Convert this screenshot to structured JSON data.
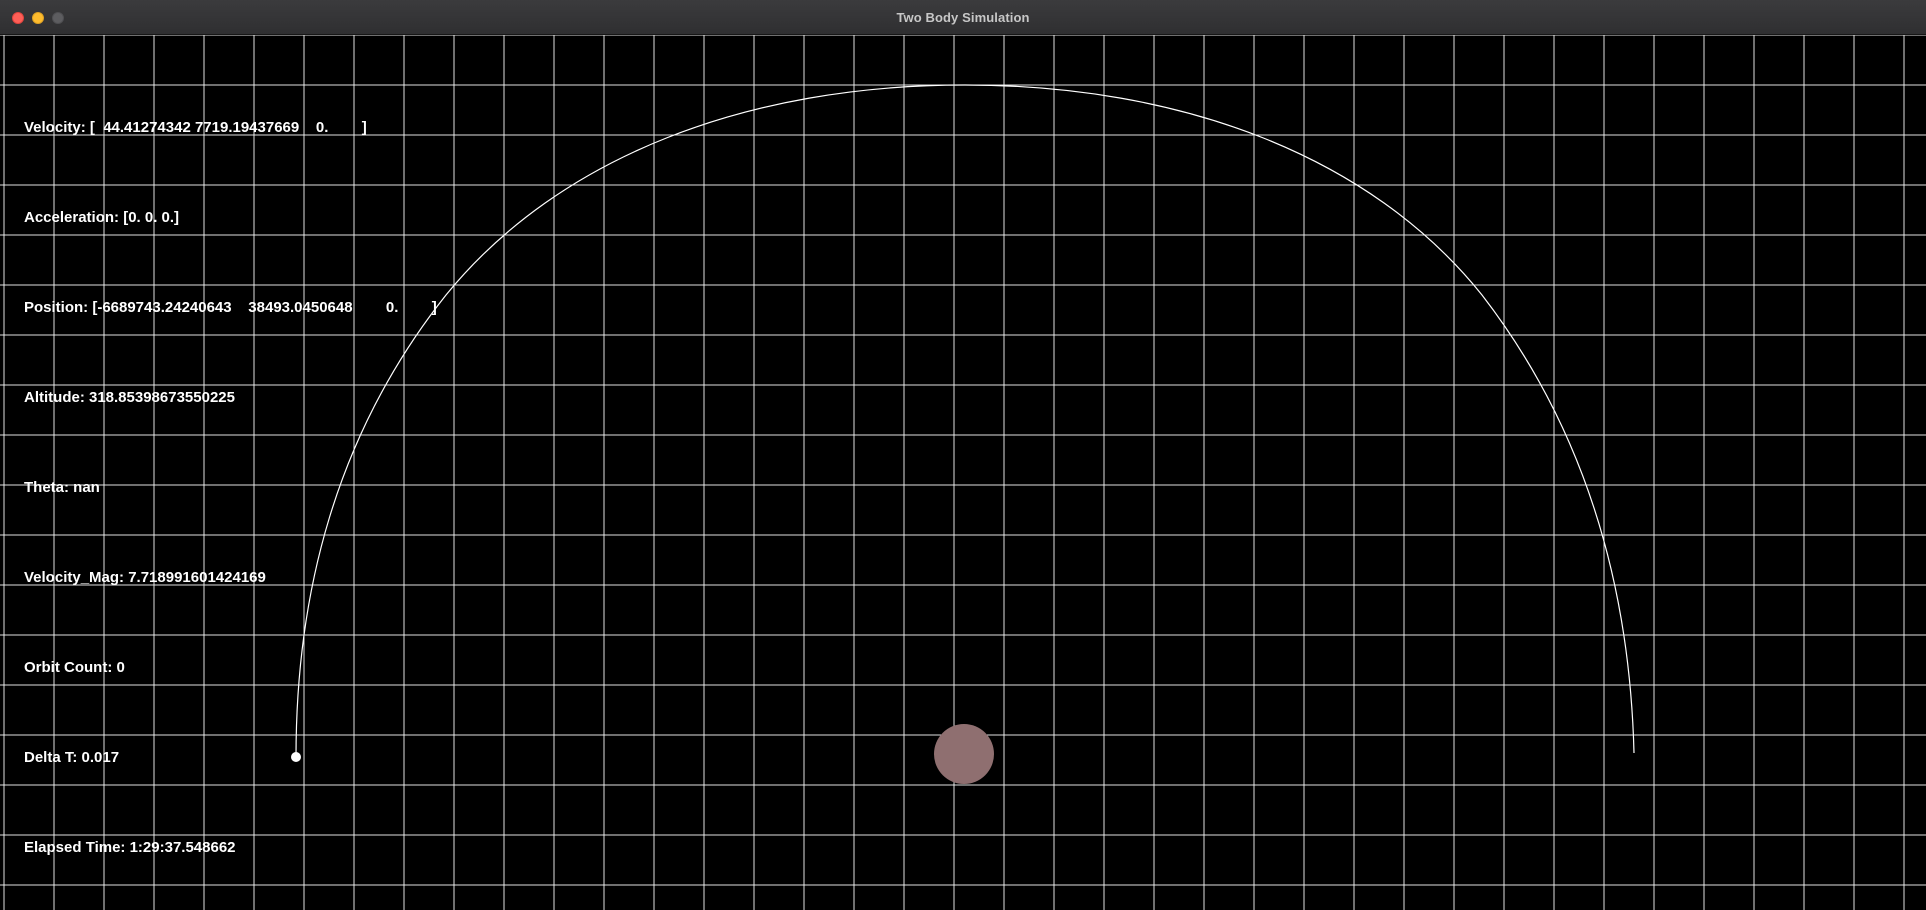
{
  "window": {
    "title": "Two Body Simulation"
  },
  "hud": {
    "velocity": "Velocity: [  44.41274342 7719.19437669    0.        ]",
    "acceleration": "Acceleration: [0. 0. 0.]",
    "position": "Position: [-6689743.24240643    38493.0450648        0.        ]",
    "altitude": "Altitude: 318.85398673550225",
    "theta": "Theta: nan",
    "velocity_mag": "Velocity_Mag: 7.718991601424169",
    "orbit_count": "Orbit Count: 0",
    "delta_t": "Delta T: 0.017",
    "elapsed_time": "Elapsed Time: 1:29:37.548662"
  },
  "icons": {
    "close": "close-icon",
    "minimize": "minimize-icon",
    "zoom": "zoom-icon"
  },
  "colors": {
    "background": "#000000",
    "grid": "#ffffff",
    "orbit_trail": "#ffffff",
    "satellite": "#ffffff",
    "planet": "#8f6f70"
  }
}
